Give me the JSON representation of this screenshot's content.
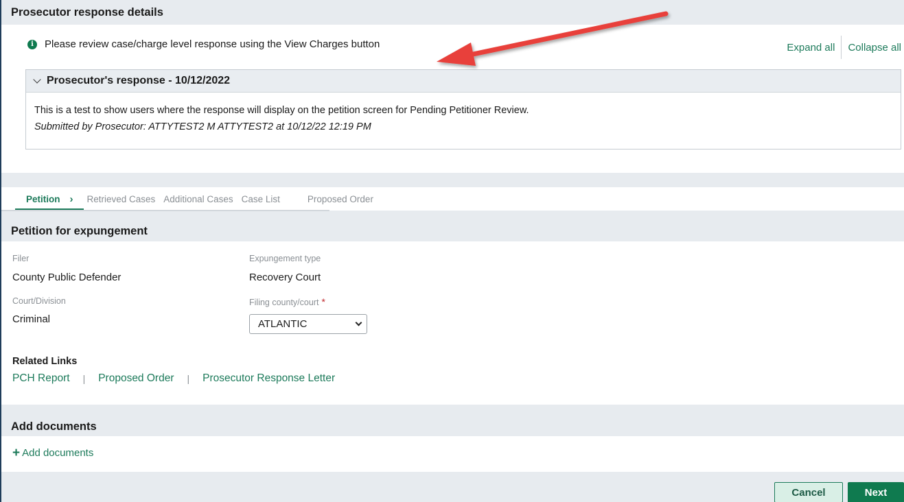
{
  "response_section": {
    "title": "Prosecutor response details",
    "info_message": "Please review case/charge level response using the View Charges button",
    "expand_all": "Expand all",
    "collapse_all": "Collapse all",
    "response_card": {
      "title": "Prosecutor's response - 10/12/2022",
      "body": "This is a test to show users where the response will display on the petition screen for Pending Petitioner Review.",
      "submitted_by": "Submitted by  Prosecutor: ATTYTEST2 M ATTYTEST2  at  10/12/22 12:19 PM"
    }
  },
  "tabs": [
    {
      "label": "Petition"
    },
    {
      "label": "Retrieved Cases"
    },
    {
      "label": "Additional Cases"
    },
    {
      "label": "Case List"
    },
    {
      "label": "Proposed Order"
    }
  ],
  "petition": {
    "title": "Petition for expungement",
    "filer_label": "Filer",
    "filer_value": "County Public Defender",
    "exp_type_label": "Expungement type",
    "exp_type_value": "Recovery Court",
    "court_label": "Court/Division",
    "court_value": "Criminal",
    "county_label": "Filing county/court",
    "required_mark": "*",
    "county_value": "ATLANTIC"
  },
  "related": {
    "title": "Related Links",
    "links": [
      "PCH Report",
      "Proposed Order",
      "Prosecutor Response Letter"
    ],
    "separator": "|"
  },
  "documents": {
    "title": "Add documents",
    "add_label": "Add documents"
  },
  "footer": {
    "cancel": "Cancel",
    "next": "Next"
  },
  "colors": {
    "accent": "#1c7a5a",
    "primary_button": "#0f7a4f",
    "annotation_arrow": "#e8413a",
    "section_band": "#e7ebef"
  },
  "icons": {
    "info": "info-circle-icon",
    "collapse": "chevron-down-icon",
    "tab_next": "chevron-right-icon",
    "add": "plus-icon",
    "select": "caret-down-icon"
  }
}
